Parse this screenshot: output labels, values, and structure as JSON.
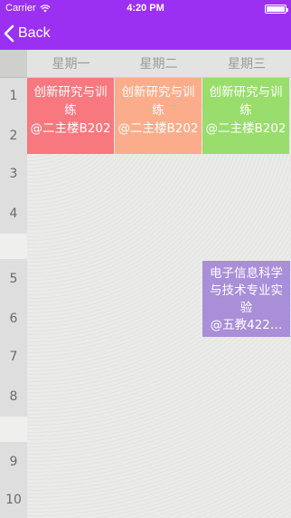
{
  "status_bar": {
    "carrier": "Carrier",
    "time": "4:20 PM",
    "battery_level": 1.0
  },
  "nav": {
    "back_label": "Back"
  },
  "schedule": {
    "days": [
      "星期一",
      "星期二",
      "星期三"
    ],
    "periods": [
      "1",
      "2",
      "3",
      "4",
      "5",
      "6",
      "7",
      "8",
      "9",
      "10"
    ],
    "courses": [
      {
        "name": "创新研究与训练",
        "room": "@二主楼B202",
        "day": "星期一",
        "periods": "1-2",
        "color": "#f8787f"
      },
      {
        "name": "创新研究与训练",
        "room": "@二主楼B202",
        "day": "星期二",
        "periods": "1-2",
        "color": "#fbad8b"
      },
      {
        "name": "创新研究与训练",
        "room": "@二主楼B202",
        "day": "星期三",
        "periods": "1-2",
        "color": "#99dd6c"
      },
      {
        "name": "电子信息科学与技术专业实验",
        "room": "@五教422…",
        "day": "星期三",
        "periods": "5-6",
        "color": "#a98ed8"
      }
    ]
  },
  "colors": {
    "accent": "#9b30f2"
  }
}
